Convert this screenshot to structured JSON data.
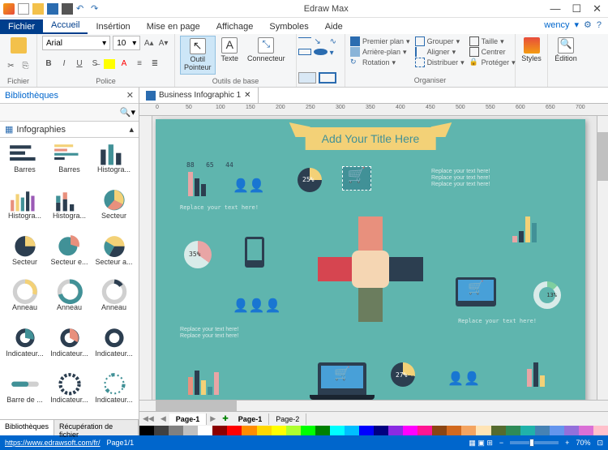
{
  "titlebar": {
    "app": "Edraw Max"
  },
  "menu": {
    "file": "Fichier",
    "tabs": [
      "Accueil",
      "Insértion",
      "Mise en page",
      "Affichage",
      "Symboles",
      "Aide"
    ],
    "user": "wency"
  },
  "ribbon": {
    "file_group": "Fichier",
    "font": {
      "name": "Arial",
      "size": "10",
      "group": "Police"
    },
    "bold": "B",
    "italic": "I",
    "underline": "U",
    "tools": {
      "pointer": "Outil\nPointeur",
      "text": "Texte",
      "connector": "Connecteur",
      "group": "Outils de base"
    },
    "organize": {
      "front": "Premier plan",
      "back": "Arrière-plan",
      "rotate": "Rotation",
      "grp": "Grouper",
      "align": "Aligner",
      "distrib": "Distribuer",
      "size": "Taille",
      "center": "Centrer",
      "protect": "Protéger",
      "group": "Organiser"
    },
    "styles": "Styles",
    "edit": "Édition"
  },
  "sidebar": {
    "title": "Bibliothèques",
    "category": "Infographies",
    "shapes": [
      "Barres",
      "Barres",
      "Histogra...",
      "Histogra...",
      "Histogra...",
      "Secteur",
      "Secteur",
      "Secteur e...",
      "Secteur a...",
      "Anneau",
      "Anneau",
      "Anneau",
      "Indicateur...",
      "Indicateur...",
      "Indicateur...",
      "Barre de ...",
      "Indicateur...",
      "Indicateur..."
    ],
    "tabs": [
      "Bibliothèques",
      "Récupération de fichier"
    ]
  },
  "doc": {
    "tab": "Business Infographic 1"
  },
  "canvas": {
    "title": "Add Your Title Here",
    "txt1": "Replace your text here!",
    "txt2": "Replace your text here!",
    "txt3": "Replace your text here!",
    "bars_tl": [
      88,
      65,
      44
    ],
    "pie_tr": 25,
    "pie_ml": 35,
    "pie_br": 27,
    "ring_r": 13,
    "bars_r": [
      17,
      30,
      86,
      63
    ],
    "bars_bl": [
      64,
      88,
      49,
      21,
      82
    ]
  },
  "pages": {
    "p1": "Page-1",
    "p2": "Page-2",
    "bold1": "Page-1"
  },
  "status": {
    "url": "https://www.edrawsoft.com/fr/",
    "page": "Page1/1",
    "zoom": "70%"
  },
  "ruler": [
    "0",
    "50",
    "100",
    "150",
    "200",
    "250",
    "300",
    "350",
    "400",
    "450",
    "500",
    "550",
    "600",
    "650",
    "700"
  ]
}
